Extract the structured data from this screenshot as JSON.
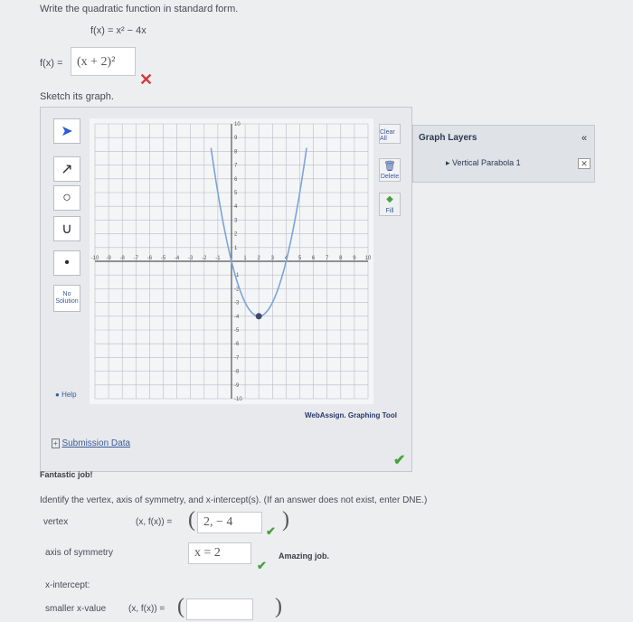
{
  "problem": {
    "prompt": "Write the quadratic function in standard form.",
    "given_lhs": "f(x) =",
    "given_rhs": "x² − 4x",
    "answer_label": "f(x) =",
    "answer_value": "(x + 2)²",
    "answer_status": "incorrect"
  },
  "sketch_prompt": "Sketch its graph.",
  "tool": {
    "no_solution": "No Solution",
    "help": "Help",
    "clear_all": "Clear All",
    "delete": "Delete",
    "fill": "Fill",
    "brand": "WebAssign. Graphing Tool",
    "submission_data": "Submission Data",
    "x_ticks": [
      "-10",
      "-9",
      "-8",
      "-7",
      "-6",
      "-5",
      "-4",
      "-3",
      "-2",
      "-1",
      "1",
      "2",
      "3",
      "4",
      "5",
      "6",
      "7",
      "8",
      "9",
      "10"
    ],
    "y_ticks": [
      "10",
      "9",
      "8",
      "7",
      "6",
      "5",
      "4",
      "3",
      "2",
      "1",
      "-1",
      "-2",
      "-3",
      "-4",
      "-5",
      "-6",
      "-7",
      "-8",
      "-9",
      "-10"
    ],
    "icons": [
      "pointer-icon",
      "line-icon",
      "circle-icon",
      "parabola-icon",
      "point-icon"
    ]
  },
  "layers": {
    "title": "Graph Layers",
    "collapse": "«",
    "item": "Vertical Parabola 1"
  },
  "chart_data": {
    "type": "line",
    "series": [
      {
        "equation": "y = (x-2)^2 - 4",
        "vertex": [
          2,
          -4
        ],
        "points": [
          [
            0,
            0
          ],
          [
            2,
            -4
          ],
          [
            4,
            0
          ]
        ]
      }
    ],
    "xlim": [
      -10,
      10
    ],
    "ylim": [
      -10,
      10
    ],
    "grid": true
  },
  "feedback": "Fantastic job!",
  "question2": "Identify the vertex, axis of symmetry, and x-intercept(s). (If an answer does not exist, enter DNE.)",
  "vertex": {
    "label": "vertex",
    "coord_label": "(x, f(x)) =",
    "value": "2, − 4"
  },
  "axis": {
    "label": "axis of symmetry",
    "value": "x = 2",
    "feedback": "Amazing job."
  },
  "xint": {
    "label": "x-intercept:",
    "smaller_label": "smaller x-value",
    "coord_label": "(x, f(x)) =",
    "value": ""
  }
}
